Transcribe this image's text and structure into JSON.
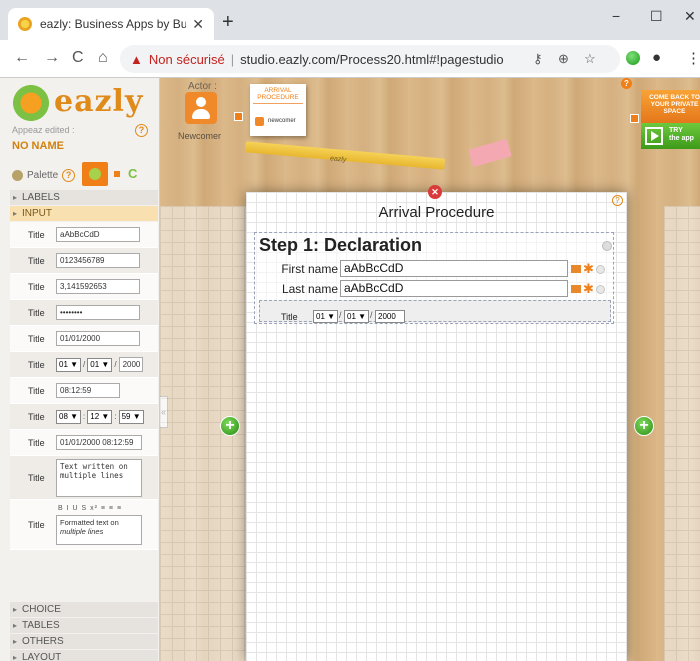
{
  "browser": {
    "tab_title": "eazly: Business Apps by Business",
    "tab_close": "✕",
    "new_tab": "+",
    "minimize": "−",
    "maximize": "☐",
    "close": "✕",
    "back": "←",
    "forward": "→",
    "reload": "C",
    "home": "⌂",
    "security_warning": "Non sécurisé",
    "separator": "|",
    "url": "studio.eazly.com/Process20.html#!pagestudio"
  },
  "sidebar": {
    "logo_text": "eazly",
    "appeaz_edited": "Appeaz edited :",
    "app_name": "NO NAME",
    "palette_label": "Palette",
    "help_glyph": "?",
    "sections_top": {
      "labels": "LABELS",
      "input": "INPUT"
    },
    "inputs": [
      {
        "label": "Title",
        "value": "aAbBcCdD"
      },
      {
        "label": "Title",
        "value": "0123456789"
      },
      {
        "label": "Title",
        "value": "3,141592653"
      },
      {
        "label": "Title",
        "value": "••••••••"
      },
      {
        "label": "Title",
        "value": "01/01/2000"
      },
      {
        "label": "Title",
        "day": "01",
        "month": "01",
        "year": "2000"
      },
      {
        "label": "Title",
        "value": "08:12:59"
      },
      {
        "label": "Title",
        "hh": "08",
        "mm": "12",
        "ss": "59"
      },
      {
        "label": "Title",
        "value": "01/01/2000 08:12:59"
      },
      {
        "label": "Title",
        "value": "Text written on multiple lines"
      },
      {
        "label": "Title",
        "toolbar": "B I U S x² ≡ ≡ ≡",
        "formatted_1": "Formatted text on",
        "formatted_2": "multiple lines"
      }
    ],
    "sections_bottom": {
      "choice": "CHOICE",
      "tables": "TABLES",
      "others": "OTHERS",
      "layout": "LAYOUT"
    },
    "collapse_glyph": "«"
  },
  "canvas": {
    "actor_label": "Actor :",
    "newcomer_label": "Newcomer",
    "card_title": "ARRIVAL PROCEDURE",
    "card_actor": "newcomer",
    "pencil_label": "eazly",
    "cta_orange": "COME BACK TO YOUR PRIVATE SPACE",
    "cta_green_1": "TRY",
    "cta_green_2": "the app",
    "add_glyph": "+",
    "close_glyph": "✕"
  },
  "panel": {
    "title": "Arrival Procedure",
    "step_title": "Step 1: Declaration",
    "first_name_label": "First name",
    "first_name_value": "aAbBcCdD",
    "last_name_label": "Last name",
    "last_name_value": "aAbBcCdD",
    "date_label": "Title",
    "date_day": "01 ▼",
    "date_month": "01 ▼",
    "date_year": "2000"
  },
  "colors": {
    "accent_orange": "#f07f18",
    "insecure_red": "#c5221f",
    "success_green": "#3d9a1a"
  }
}
